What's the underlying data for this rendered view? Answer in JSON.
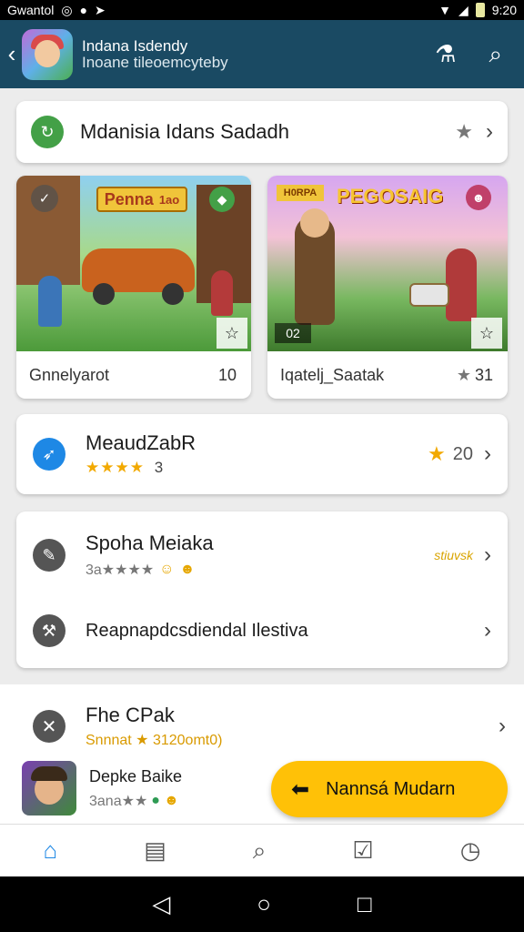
{
  "status": {
    "left_text": "Gwantol",
    "time": "9:20"
  },
  "appbar": {
    "back_icon": "arrow-left-icon",
    "title": "Indana Isdendy",
    "subtitle": "Inoane tileoemcyteby",
    "actions": [
      "flask-icon",
      "search-icon"
    ]
  },
  "search_card": {
    "label": "Mdanisia Idans Sadadh"
  },
  "tiles": [
    {
      "banner": "Penna",
      "banner2": "1ao",
      "caption": "Gnnelyarot",
      "value": "10"
    },
    {
      "banner": "PEGOSAIG",
      "badge": "H0RPA",
      "overlay_num": "02",
      "caption": "Iqatelj_Saatak",
      "value": "31",
      "star": "★"
    }
  ],
  "card_mena": {
    "title": "MeaudZabR",
    "rating_count": "3",
    "stars": "★★★★",
    "right_value": "20"
  },
  "group_card": {
    "row1": {
      "title": "Spoha Meiaka",
      "subtitle": "3a★★★★",
      "right_tag": "stiuvsk"
    },
    "row2": {
      "title": "Reapnapdcsdiendal Ilestiva"
    }
  },
  "fhe_card": {
    "title": "Fhe CPak",
    "subtitle": "Snnnat ★ 3120omt0)"
  },
  "mini": {
    "title": "Depke Baike",
    "subtitle": "3ana★★"
  },
  "cta": {
    "label": "Nannsá Mudarn"
  },
  "nav": [
    "home-icon",
    "library-icon",
    "search-icon",
    "check-box-icon",
    "compass-icon"
  ],
  "colors": {
    "appbar": "#1a4a63",
    "green": "#43a047",
    "blue": "#1e88e5",
    "cta": "#ffc107"
  }
}
